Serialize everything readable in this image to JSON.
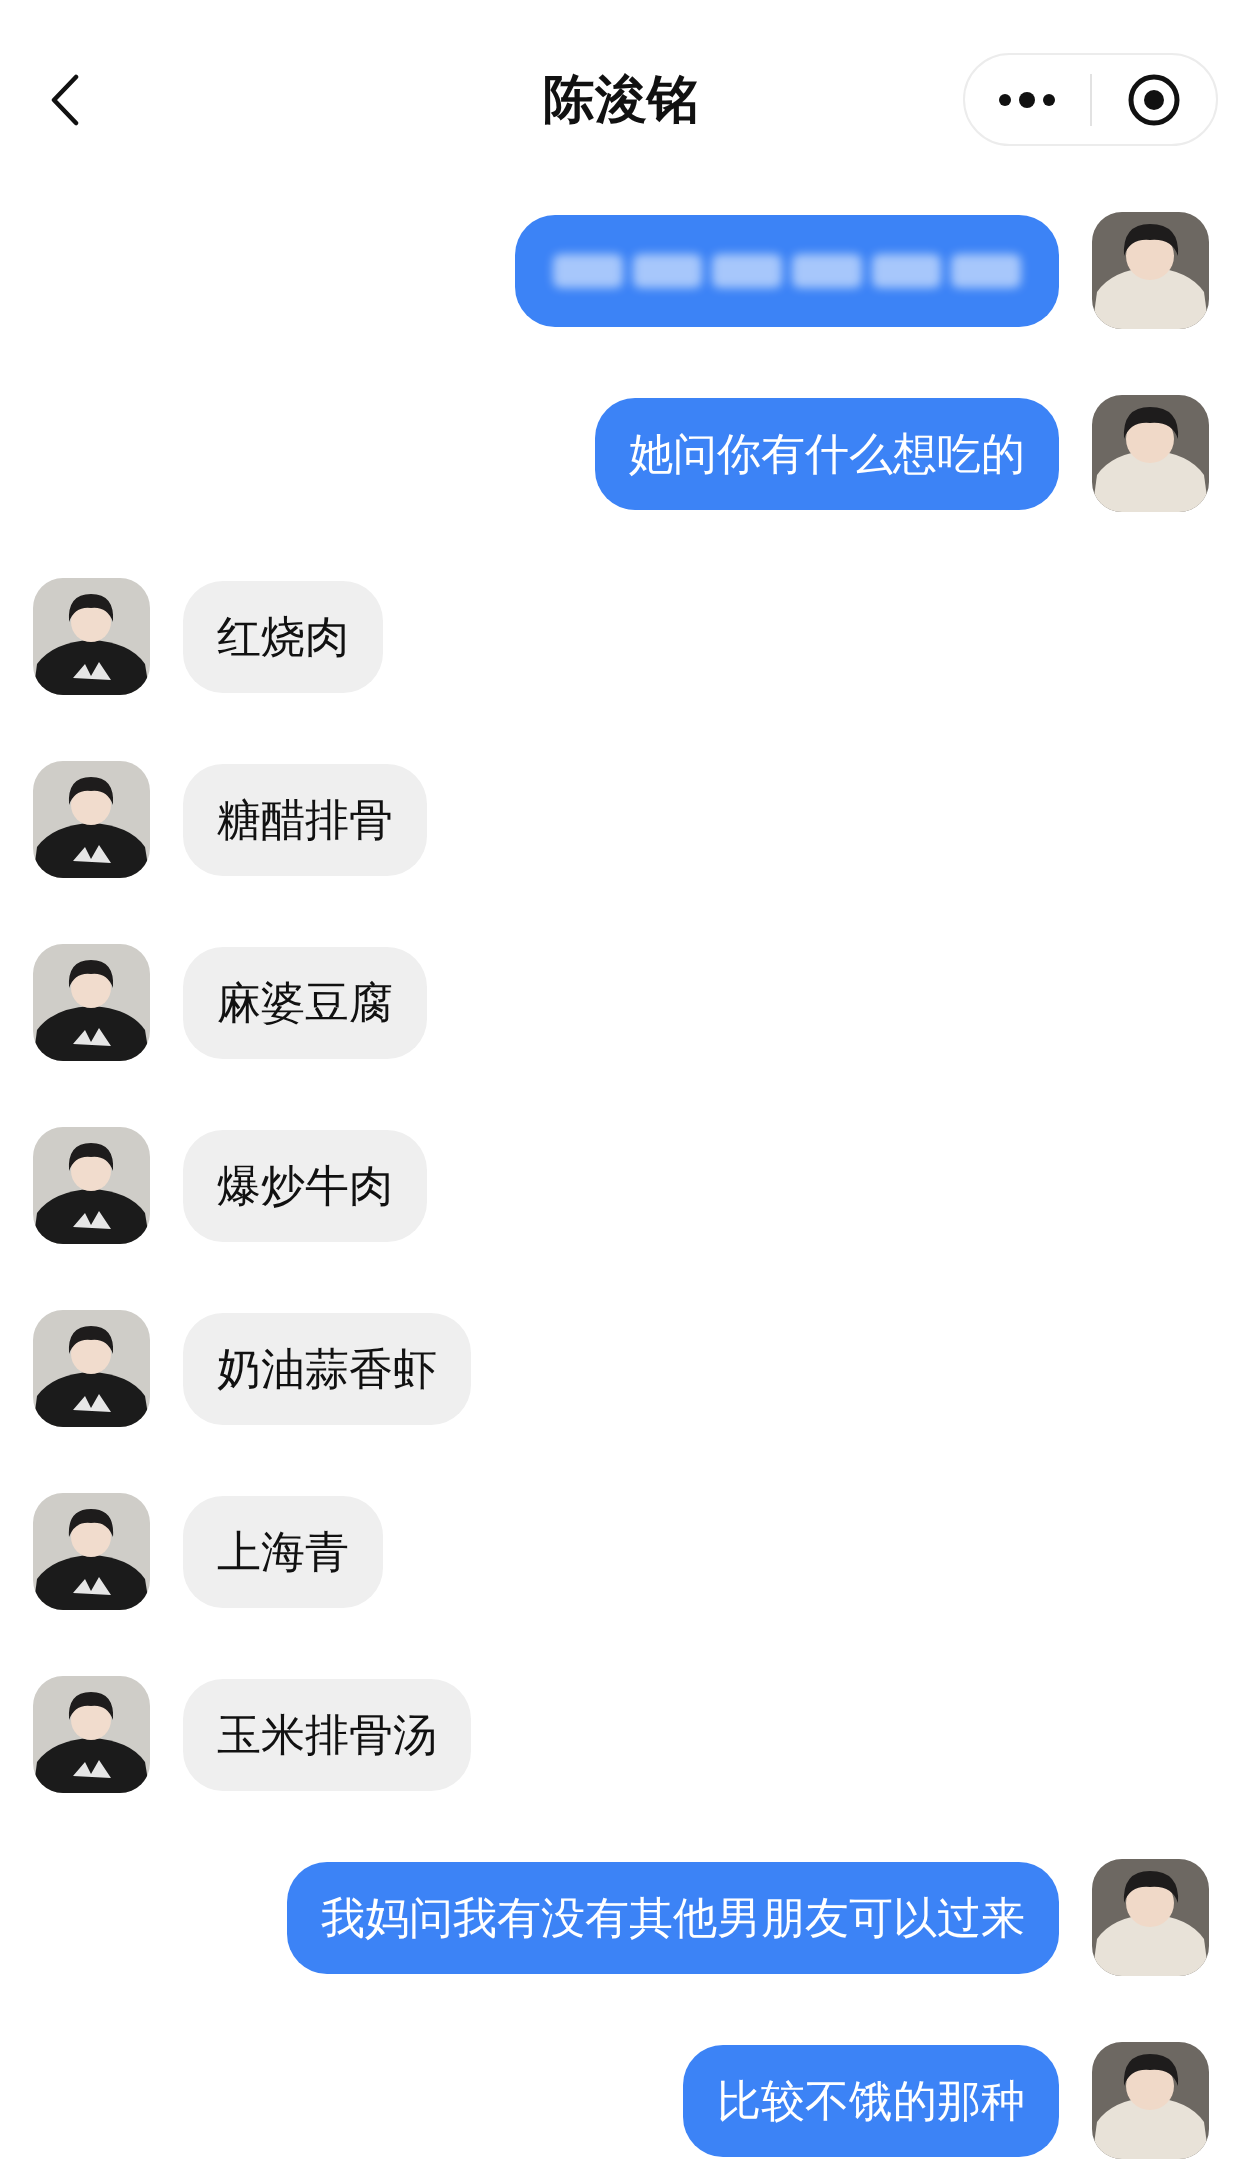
{
  "header": {
    "title": "陈浚铭"
  },
  "messages": [
    {
      "outgoing": true,
      "kind": "blurred"
    },
    {
      "outgoing": true,
      "kind": "text",
      "text": "她问你有什么想吃的"
    },
    {
      "outgoing": false,
      "kind": "text",
      "text": "红烧肉"
    },
    {
      "outgoing": false,
      "kind": "text",
      "text": "糖醋排骨"
    },
    {
      "outgoing": false,
      "kind": "text",
      "text": "麻婆豆腐"
    },
    {
      "outgoing": false,
      "kind": "text",
      "text": "爆炒牛肉"
    },
    {
      "outgoing": false,
      "kind": "text",
      "text": "奶油蒜香虾"
    },
    {
      "outgoing": false,
      "kind": "text",
      "text": "上海青"
    },
    {
      "outgoing": false,
      "kind": "text",
      "text": "玉米排骨汤"
    },
    {
      "outgoing": true,
      "kind": "text",
      "text": "我妈问我有没有其他男朋友可以过来"
    },
    {
      "outgoing": true,
      "kind": "text",
      "text": "比较不饿的那种"
    }
  ]
}
